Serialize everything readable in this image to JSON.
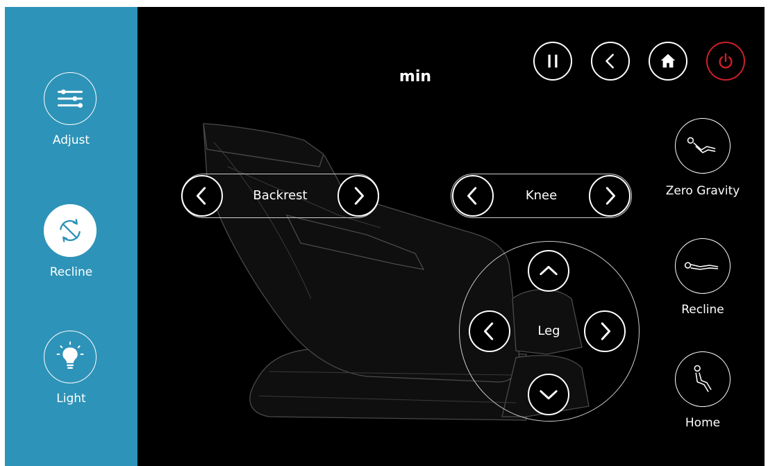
{
  "sidebar": {
    "items": [
      {
        "label": "Adjust",
        "icon": "sliders-icon",
        "active": false
      },
      {
        "label": "Recline",
        "icon": "recline-swap-icon",
        "active": true
      },
      {
        "label": "Light",
        "icon": "lightbulb-icon",
        "active": false
      }
    ]
  },
  "header": {
    "title": "min",
    "buttons": [
      {
        "icon": "pause-icon"
      },
      {
        "icon": "back-icon"
      },
      {
        "icon": "home-icon"
      },
      {
        "icon": "power-icon",
        "color": "#d01f2a"
      }
    ]
  },
  "controls": {
    "backrest_label": "Backrest",
    "knee_label": "Knee",
    "leg_label": "Leg"
  },
  "presets": {
    "items": [
      {
        "label": "Zero Gravity",
        "icon": "zero-gravity-icon"
      },
      {
        "label": "Recline",
        "icon": "recline-icon"
      },
      {
        "label": "Home",
        "icon": "seated-home-icon"
      }
    ]
  },
  "colors": {
    "accent": "#2e93b8",
    "background": "#000000",
    "power": "#d01f2a"
  }
}
